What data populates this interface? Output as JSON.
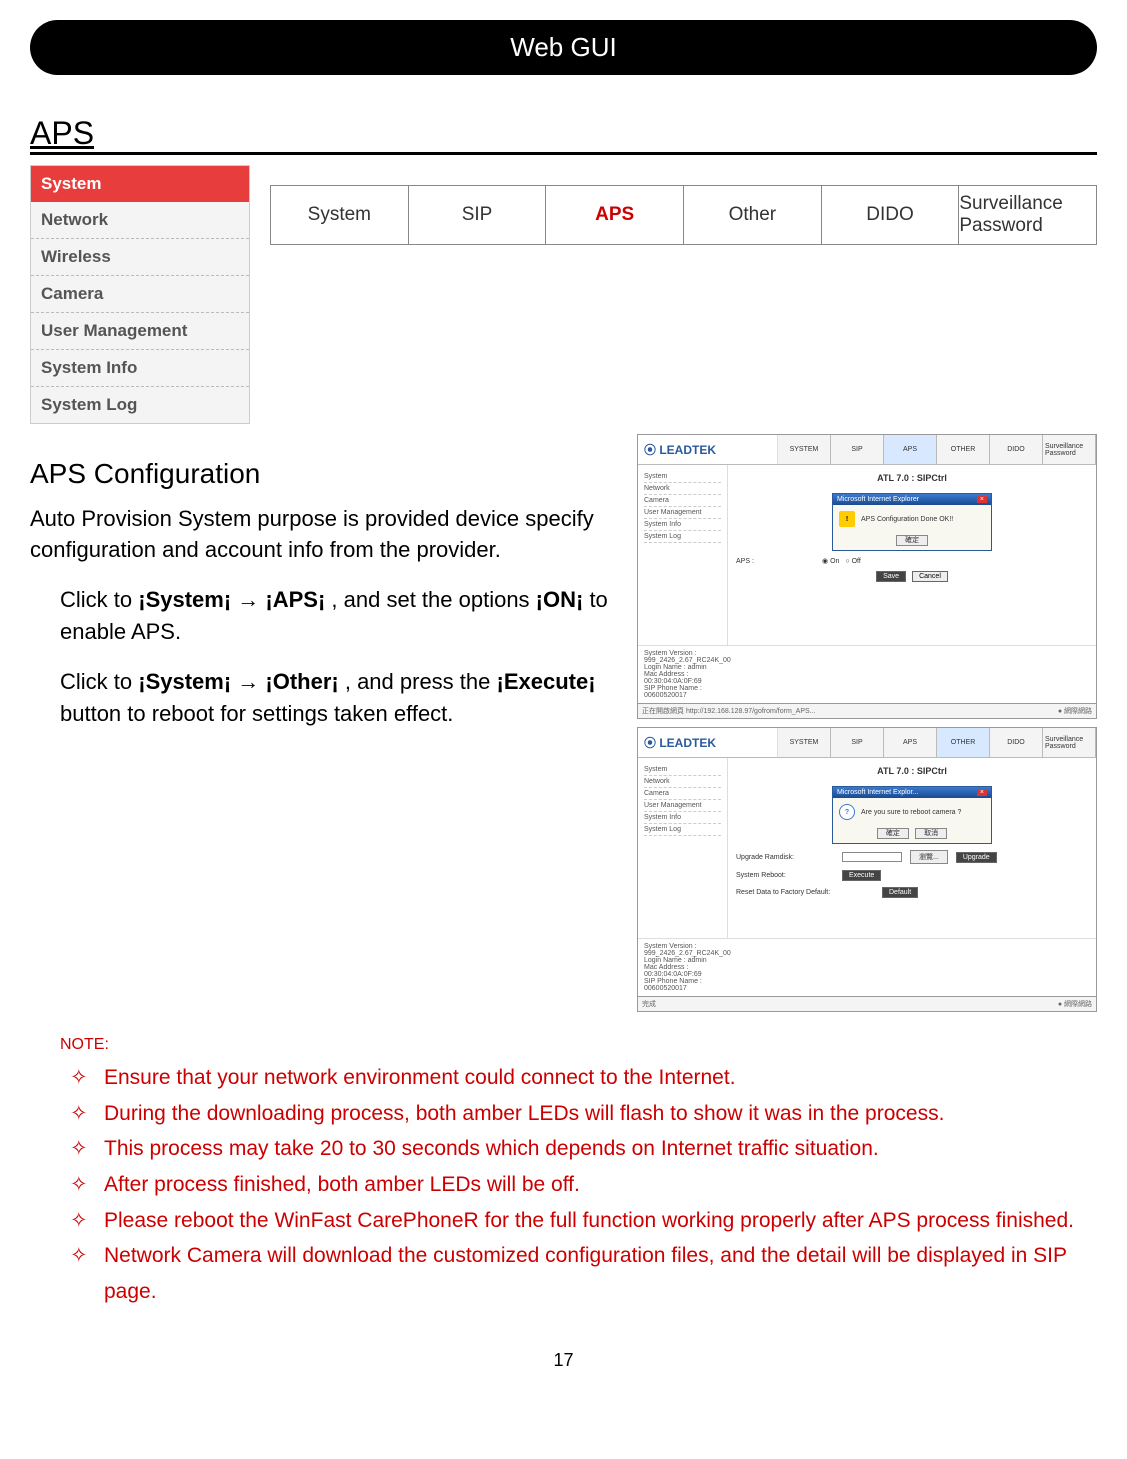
{
  "header": "Web GUI",
  "section": "APS",
  "sidebar": {
    "items": [
      "System",
      "Network",
      "Wireless",
      "Camera",
      "User Management",
      "System Info",
      "System Log"
    ],
    "active_index": 0
  },
  "tabs": {
    "items": [
      "System",
      "SIP",
      "APS",
      "Other",
      "DIDO",
      "Surveillance Password"
    ],
    "active_index": 2
  },
  "subheading": "APS Configuration",
  "intro": "Auto Provision System purpose is provided device specify configuration and account info from the provider.",
  "step1_pre": "Click to ",
  "step1_b1": "¡System¡",
  "step1_arrow": " → ",
  "step1_b2": "¡APS¡",
  "step1_mid": " , and set the options ",
  "step1_b3": "¡ON¡",
  "step1_post": " to enable APS.",
  "step2_pre": "Click to ",
  "step2_b1": "¡System¡",
  "step2_arrow": " → ",
  "step2_b2": "¡Other¡",
  "step2_mid": " , and press the ",
  "step2_b3": "¡Execute¡",
  "step2_post": " button to reboot for settings taken effect.",
  "note_label": "NOTE:",
  "notes": [
    "Ensure that your network environment could connect to the Internet.",
    "During the downloading process, both amber LEDs will flash to show it was in the process.",
    "This process may take 20 to 30 seconds which depends on Internet traffic situation.",
    "After process finished, both amber LEDs will be off.",
    "Please reboot the WinFast CarePhoneR for the full function working properly after APS process finished.",
    "Network Camera will download the customized configuration files, and the detail will be displayed in SIP page."
  ],
  "page_number": "17",
  "shot_common": {
    "logo": "⦿ LEADTEK",
    "tabs": [
      "SYSTEM",
      "SIP",
      "APS",
      "OTHER",
      "DIDO",
      "Surveillance Password"
    ],
    "side": [
      "System",
      "Network",
      "Camera",
      "User Management",
      "System Info",
      "System Log"
    ],
    "title": "ATL 7.0 : SIPCtrl",
    "info_version_label": "System Version :",
    "info_version": "999_2426_2.67_RC24K_00",
    "info_login_label": "Login Name :",
    "info_login": "admin",
    "info_mac_label": "Mac Address :",
    "info_mac": "00:30:04:0A:0F:69",
    "info_phone_label": "SIP Phone Name :",
    "info_phone": "00600520017",
    "status_right": "● 網際網路"
  },
  "shot1": {
    "active_tab_index": 2,
    "dialog_title": "Microsoft Internet Explorer",
    "dialog_msg": "APS Configuration Done OK!!",
    "dialog_btn": "確定",
    "aps_label": "APS :",
    "aps_on": "On",
    "aps_off": "Off",
    "save": "Save",
    "cancel": "Cancel",
    "status_left": "正在開啟網頁 http://192.168.128.97/gofrom/form_APS..."
  },
  "shot2": {
    "active_tab_index": 3,
    "dialog_title": "Microsoft Internet Explor...",
    "dialog_msg": "Are you sure to reboot camera ?",
    "dialog_ok": "確定",
    "dialog_cancel": "取消",
    "row_upgrade_label": "Upgrade Ramdisk:",
    "row_upgrade_browse": "瀏覽...",
    "row_upgrade_btn": "Upgrade",
    "row_reboot_label": "System Reboot:",
    "row_reboot_btn": "Execute",
    "row_reset_label": "Reset Data to Factory Default:",
    "row_reset_btn": "Default",
    "status_left": "完成"
  }
}
